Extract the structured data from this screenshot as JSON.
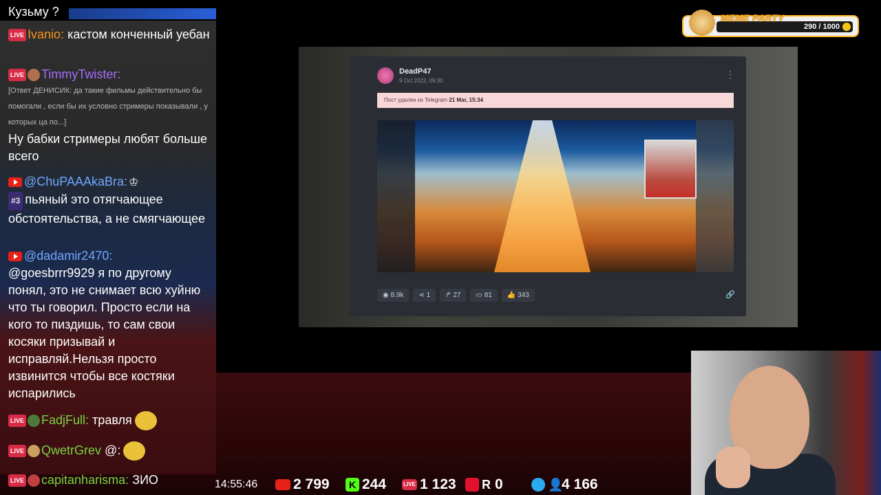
{
  "chat": {
    "messages": [
      {
        "text": "Кузьму ?"
      },
      {
        "badge": "LIVE",
        "nick": "Ivanio:",
        "text": "кастом конченный уебан"
      },
      {
        "badge": "LIVE",
        "nick": "TimmyTwister:",
        "reply": "[Ответ ДЕНИСИК: да такие фильмы действительно бы помогали , если бы их условно стримеры показывали , у которых ца по...]",
        "text": "Ну бабки стримеры любят больше всего"
      },
      {
        "badge": "YT",
        "nick": "@ChuPAAAkaBra:",
        "rank": "#3",
        "text": "пьяный это отягчающее обстоятельства, а не смягчающее"
      },
      {
        "badge": "YT",
        "nick": "@dadamir2470:",
        "text": "@goesbrrr9929 я по другому понял, это не снимает всю хуйню что ты говорил. Просто если на кого то пиздишь, то сам свои косяки призывай и исправляй.Нельзя просто извинится чтобы все костяки испарились"
      },
      {
        "badge": "LIVE",
        "nick": "FadjFull:",
        "text": "травля"
      },
      {
        "badge": "LIVE",
        "nick": "QwetrGrev",
        "text": "@:"
      },
      {
        "badge": "LIVE",
        "nick": "capitanharisma:",
        "text": "ЗИО"
      }
    ]
  },
  "post": {
    "author": "DeadP47",
    "date": "9 Oct 2022, 09:30",
    "alert_prefix": "Пост удален из Telegram",
    "alert_time": "21 Mar, 15:34",
    "menu": "⋮",
    "stats": [
      "8.9k",
      "1",
      "27",
      "81",
      "343"
    ],
    "stat_icons": [
      "eye-icon",
      "share-icon",
      "forward-icon",
      "comments-icon",
      "like-icon"
    ],
    "link_icon": "link-icon"
  },
  "meme_party": {
    "title": "MEME PARTY",
    "score": "290 / 1000"
  },
  "bottom_bar": {
    "time": "14:55:46",
    "youtube": "2 799",
    "kick": "244",
    "live": "1 123",
    "rutube": "0",
    "telegram": "4 166"
  },
  "colors": {
    "live_badge": "#d82b45",
    "youtube": "#e62117",
    "kick": "#53fc18",
    "telegram": "#2aabee",
    "meme_accent": "#ffb627"
  }
}
